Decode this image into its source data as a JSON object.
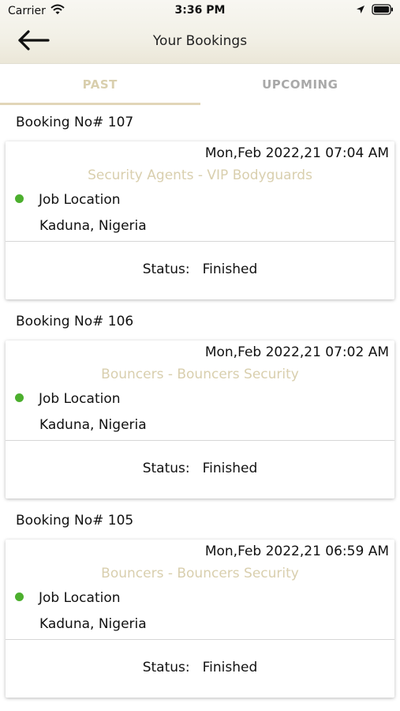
{
  "status_bar": {
    "carrier": "Carrier",
    "time": "3:36 PM",
    "wifi_icon": "wifi-icon",
    "location_icon": "location-arrow-icon",
    "battery_icon": "battery-icon"
  },
  "nav": {
    "title": "Your Bookings",
    "back_icon": "back-arrow-icon"
  },
  "tabs": [
    {
      "label": "PAST",
      "active": true
    },
    {
      "label": "UPCOMING",
      "active": false
    }
  ],
  "colors": {
    "accent": "#d9cfae",
    "inactive_tab": "#a9a9a9",
    "location_dot": "#4caf2e"
  },
  "bookings": [
    {
      "number_label": "Booking No# 107",
      "datetime": "Mon,Feb 2022,21 07:04 AM",
      "service": "Security Agents - VIP Bodyguards",
      "location_label": "Job Location",
      "location": "Kaduna, Nigeria",
      "status_label": "Status:",
      "status": "Finished"
    },
    {
      "number_label": "Booking No# 106",
      "datetime": "Mon,Feb 2022,21 07:02 AM",
      "service": "Bouncers - Bouncers Security",
      "location_label": "Job Location",
      "location": "Kaduna, Nigeria",
      "status_label": "Status:",
      "status": "Finished"
    },
    {
      "number_label": "Booking No# 105",
      "datetime": "Mon,Feb 2022,21 06:59 AM",
      "service": "Bouncers - Bouncers Security",
      "location_label": "Job Location",
      "location": "Kaduna, Nigeria",
      "status_label": "Status:",
      "status": "Finished"
    }
  ]
}
